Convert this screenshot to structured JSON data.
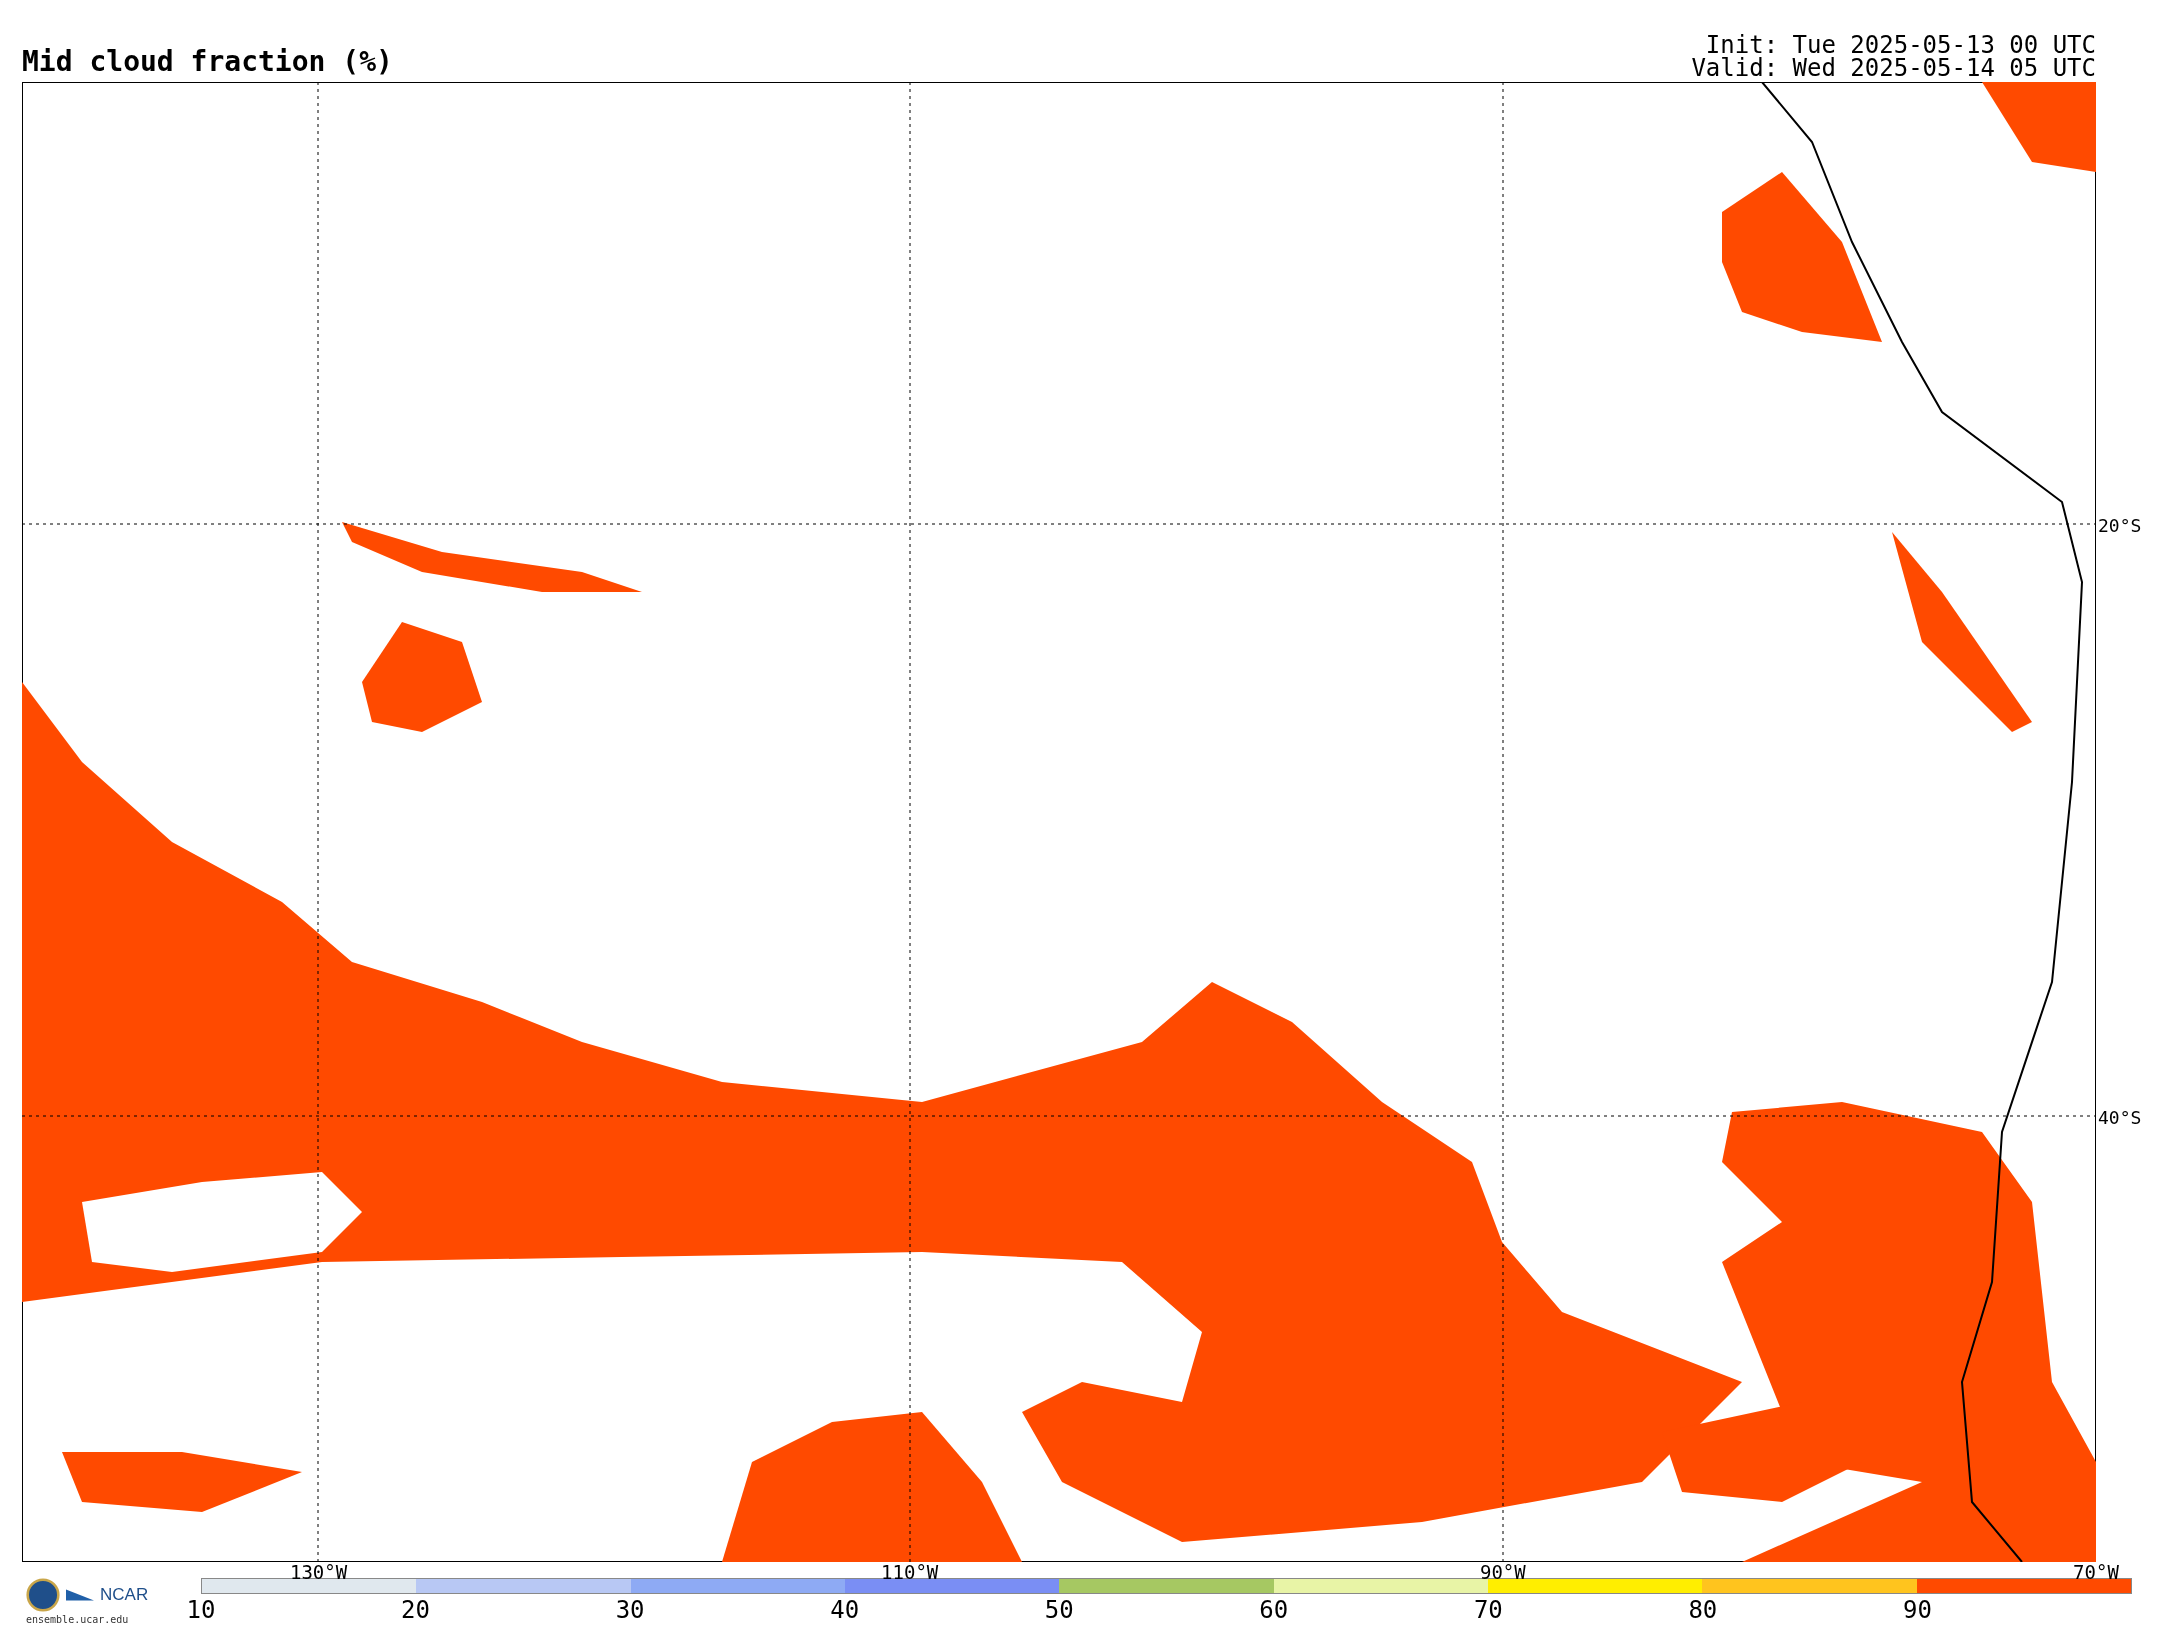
{
  "title": "Mid cloud fraction (%)",
  "init": "Init: Tue 2025-05-13 00 UTC",
  "valid": "Valid: Wed 2025-05-14 05 UTC",
  "map": {
    "lat_labels": [
      "20°S",
      "40°S"
    ],
    "lon_labels": [
      "130°W",
      "110°W",
      "90°W",
      "70°W"
    ]
  },
  "colorbar": {
    "segments": [
      {
        "color": "#e0e8ee"
      },
      {
        "color": "#b8c8f4"
      },
      {
        "color": "#8eaaf4"
      },
      {
        "color": "#7a8ef4"
      },
      {
        "color": "#a6c862"
      },
      {
        "color": "#e8f4a6"
      },
      {
        "color": "#ffee00"
      },
      {
        "color": "#ffc41e"
      },
      {
        "color": "#ff4a00"
      }
    ],
    "ticks": [
      "10",
      "20",
      "30",
      "40",
      "50",
      "60",
      "70",
      "80",
      "90"
    ]
  },
  "logo": {
    "org": "NCAR",
    "site": "ensemble.ucar.edu"
  }
}
